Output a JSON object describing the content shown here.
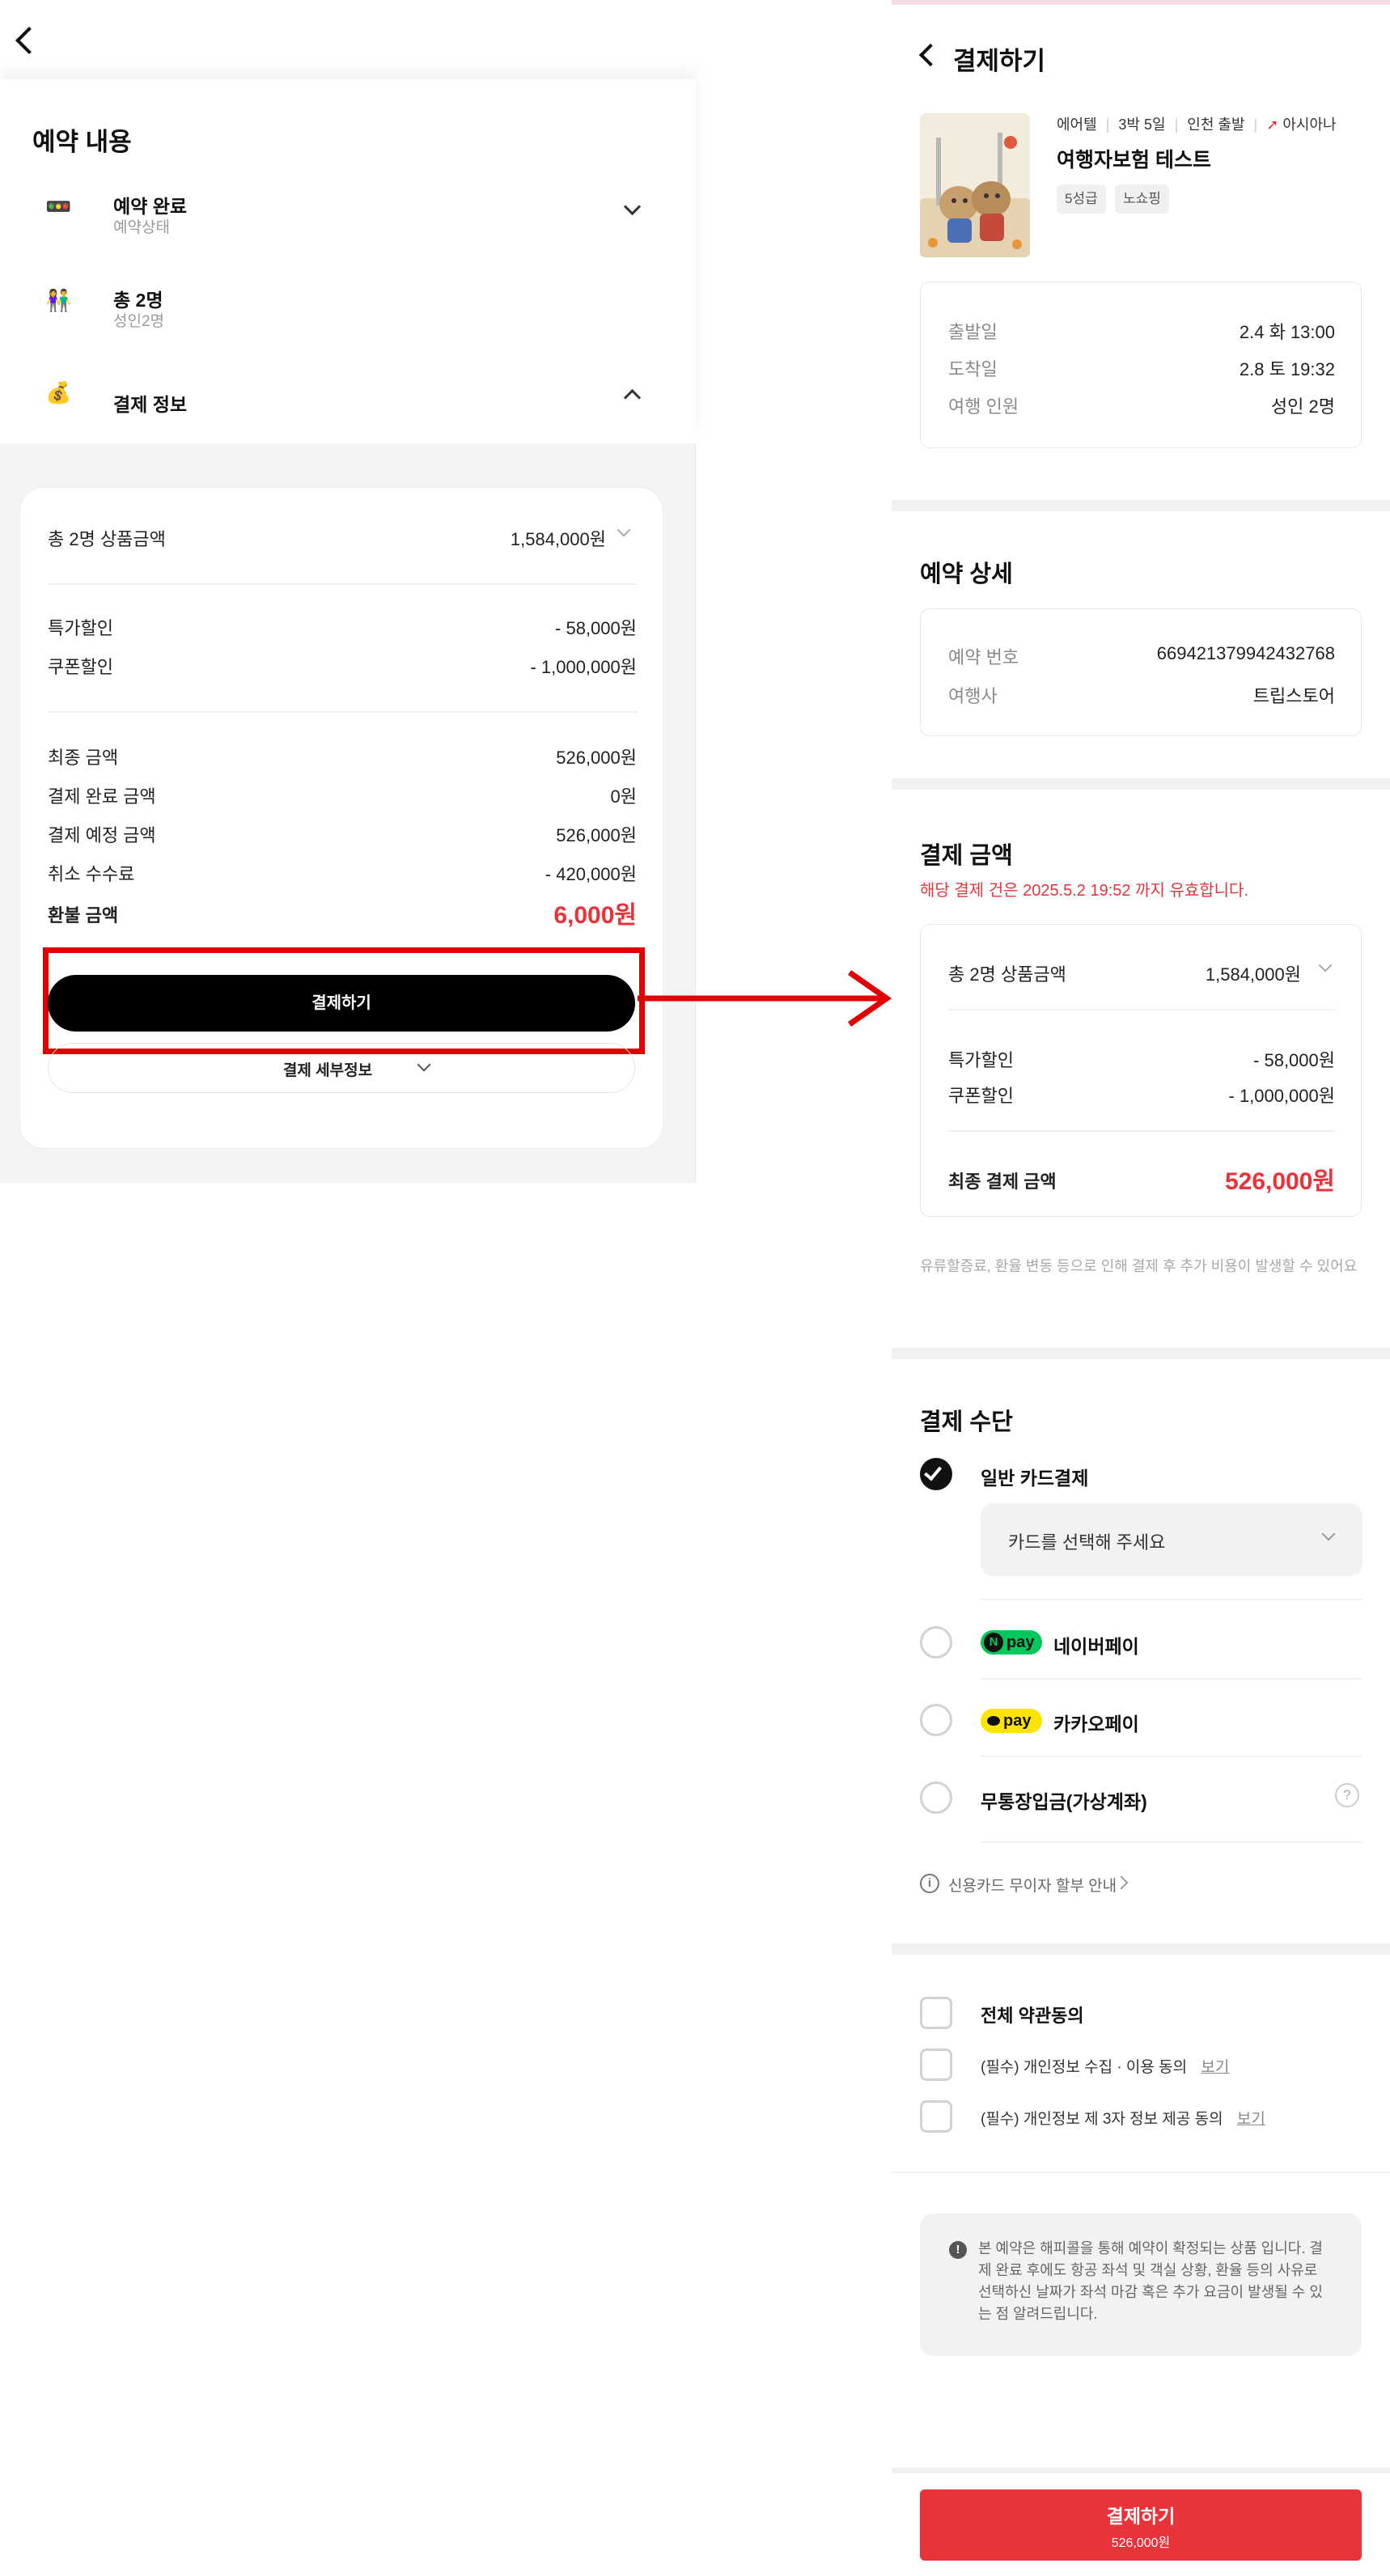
{
  "left": {
    "section_title": "예약 내용",
    "rows": [
      {
        "title": "예약 완료",
        "sub": "예약상태",
        "icon": "traffic-light-icon",
        "emoji": "🚥"
      },
      {
        "title": "총 2명",
        "sub": "성인2명",
        "icon": "people-icon",
        "emoji": "👫"
      },
      {
        "title": "결제 정보",
        "sub": "",
        "icon": "money-bag-icon",
        "emoji": "💰"
      }
    ],
    "summary": {
      "total_label": "총 2명 상품금액",
      "total_value": "1,584,000원",
      "discounts": [
        {
          "label": "특가할인",
          "value": "- 58,000원"
        },
        {
          "label": "쿠폰할인",
          "value": "- 1,000,000원"
        }
      ],
      "details": [
        {
          "label": "최종 금액",
          "value": "526,000원"
        },
        {
          "label": "결제 완료 금액",
          "value": "0원"
        },
        {
          "label": "결제 예정 금액",
          "value": "526,000원"
        },
        {
          "label": "취소 수수료",
          "value": "- 420,000원"
        }
      ],
      "refund_label": "환불 금액",
      "refund_value": "6,000원"
    },
    "pay_button": "결제하기",
    "detail_button": "결제 세부정보"
  },
  "right": {
    "header_title": "결제하기",
    "product": {
      "meta": [
        "에어텔",
        "3박 5일",
        "인천 출발"
      ],
      "airline": "아시아나",
      "name": "여행자보험 테스트",
      "tags": [
        "5성급",
        "노쇼핑"
      ]
    },
    "trip_info": [
      {
        "label": "출발일",
        "value": "2.4 화 13:00"
      },
      {
        "label": "도착일",
        "value": "2.8 토 19:32"
      },
      {
        "label": "여행 인원",
        "value": "성인 2명"
      }
    ],
    "booking": {
      "title": "예약 상세",
      "rows": [
        {
          "label": "예약 번호",
          "value": "669421379942432768"
        },
        {
          "label": "여행사",
          "value": "트립스토어"
        }
      ]
    },
    "payment_amount": {
      "title": "결제 금액",
      "notice": "해당 결제 건은 2025.5.2 19:52 까지 유효합니다.",
      "total_label": "총 2명 상품금액",
      "total_value": "1,584,000원",
      "discounts": [
        {
          "label": "특가할인",
          "value": "- 58,000원"
        },
        {
          "label": "쿠폰할인",
          "value": "- 1,000,000원"
        }
      ],
      "final_label": "최종 결제 금액",
      "final_value": "526,000원",
      "footnote": "유류할증료, 환율 변동 등으로 인해 결제 후 추가 비용이 발생할 수 있어요"
    },
    "payment_method": {
      "title": "결제 수단",
      "options": [
        {
          "label": "일반 카드결제",
          "selected": true
        },
        {
          "label": "네이버페이",
          "badge": "pay",
          "badge_prefix": "N"
        },
        {
          "label": "카카오페이",
          "badge": "pay"
        },
        {
          "label": "무통장입금(가상계좌)"
        }
      ],
      "card_placeholder": "카드를 선택해 주세요",
      "installment_notice": "신용카드 무이자 할부 안내",
      "help_glyph": "?"
    },
    "agreements": {
      "all": "전체 약관동의",
      "items": [
        {
          "label": "(필수) 개인정보 수집 · 이용 동의",
          "link": "보기"
        },
        {
          "label": "(필수) 개인정보 제 3자 정보 제공 동의",
          "link": "보기"
        }
      ]
    },
    "notice_box": "본 예약은 해피콜을 통해 예약이 확정되는 상품 입니다. 결제 완료 후에도 항공 좌석 및 객실 상황, 환율 등의 사유로 선택하신 날짜가 좌석 마감 혹은 추가 요금이 발생될 수 있는 점 알려드립니다.",
    "bottom_button": {
      "label": "결제하기",
      "amount": "526,000원"
    }
  },
  "colors": {
    "accent_red": "#e8333a",
    "annotation_red": "#e00000",
    "naver_green": "#03c75a",
    "kakao_yellow": "#fee500"
  }
}
